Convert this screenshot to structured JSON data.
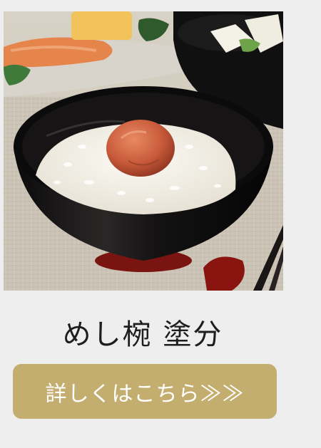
{
  "product": {
    "title": "めし椀 塗分",
    "image_alt": "",
    "details_button_label": "詳しくはこちら≫≫"
  },
  "colors": {
    "page_background": "#eeeeee",
    "button_background": "#c4ae6f",
    "button_text": "#ffffff",
    "title_text": "#1e1e1e"
  }
}
